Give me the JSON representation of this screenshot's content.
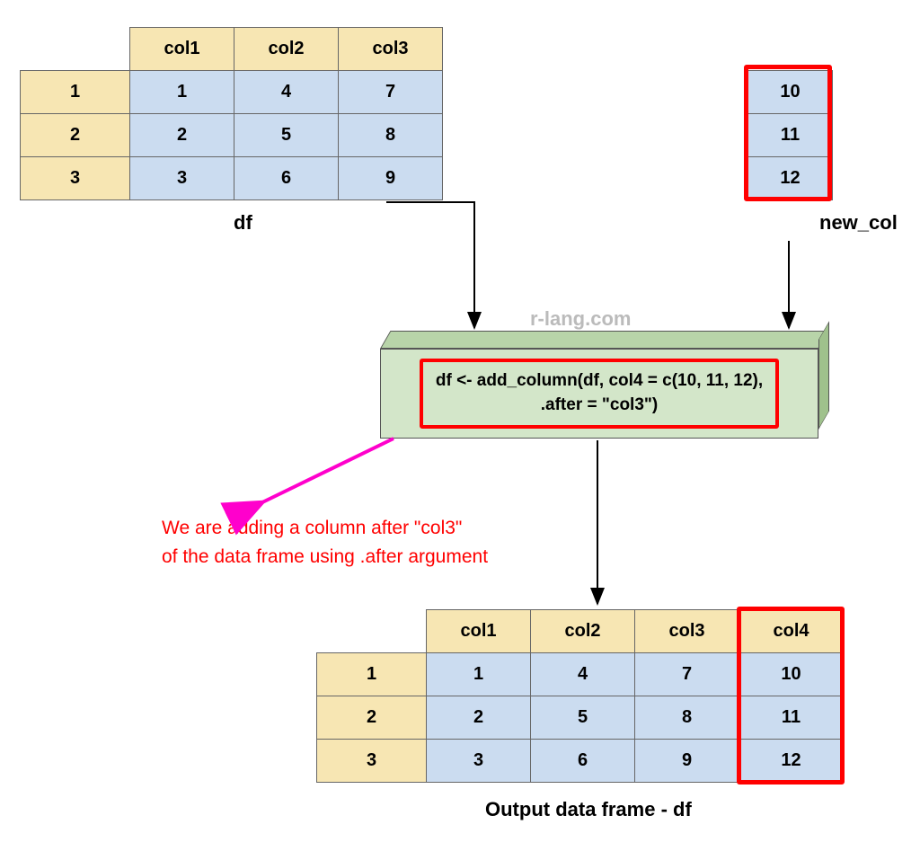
{
  "input_df": {
    "label": "df",
    "headers": [
      "col1",
      "col2",
      "col3"
    ],
    "rows": [
      {
        "idx": "1",
        "cells": [
          "1",
          "4",
          "7"
        ]
      },
      {
        "idx": "2",
        "cells": [
          "2",
          "5",
          "8"
        ]
      },
      {
        "idx": "3",
        "cells": [
          "3",
          "6",
          "9"
        ]
      }
    ]
  },
  "new_col": {
    "label": "new_col",
    "values": [
      "10",
      "11",
      "12"
    ]
  },
  "code": {
    "line1": "df <- add_column(df, col4 = c(10, 11, 12),",
    "line2": ".after = \"col3\")"
  },
  "watermark": "r-lang.com",
  "annotation": {
    "line1": "We are adding a column after \"col3\"",
    "line2": "of the data frame using .after argument"
  },
  "output_df": {
    "label": "Output data frame - df",
    "headers": [
      "col1",
      "col2",
      "col3",
      "col4"
    ],
    "rows": [
      {
        "idx": "1",
        "cells": [
          "1",
          "4",
          "7",
          "10"
        ]
      },
      {
        "idx": "2",
        "cells": [
          "2",
          "5",
          "8",
          "11"
        ]
      },
      {
        "idx": "3",
        "cells": [
          "3",
          "6",
          "9",
          "12"
        ]
      }
    ]
  },
  "chart_data": {
    "type": "table",
    "inputs": {
      "df": {
        "columns": [
          "col1",
          "col2",
          "col3"
        ],
        "index": [
          1,
          2,
          3
        ],
        "data": [
          [
            1,
            4,
            7
          ],
          [
            2,
            5,
            8
          ],
          [
            3,
            6,
            9
          ]
        ]
      },
      "new_col": [
        10,
        11,
        12
      ]
    },
    "operation": "df <- add_column(df, col4 = c(10, 11, 12), .after = \"col3\")",
    "output": {
      "columns": [
        "col1",
        "col2",
        "col3",
        "col4"
      ],
      "index": [
        1,
        2,
        3
      ],
      "data": [
        [
          1,
          4,
          7,
          10
        ],
        [
          2,
          5,
          8,
          11
        ],
        [
          3,
          6,
          9,
          12
        ]
      ]
    }
  }
}
